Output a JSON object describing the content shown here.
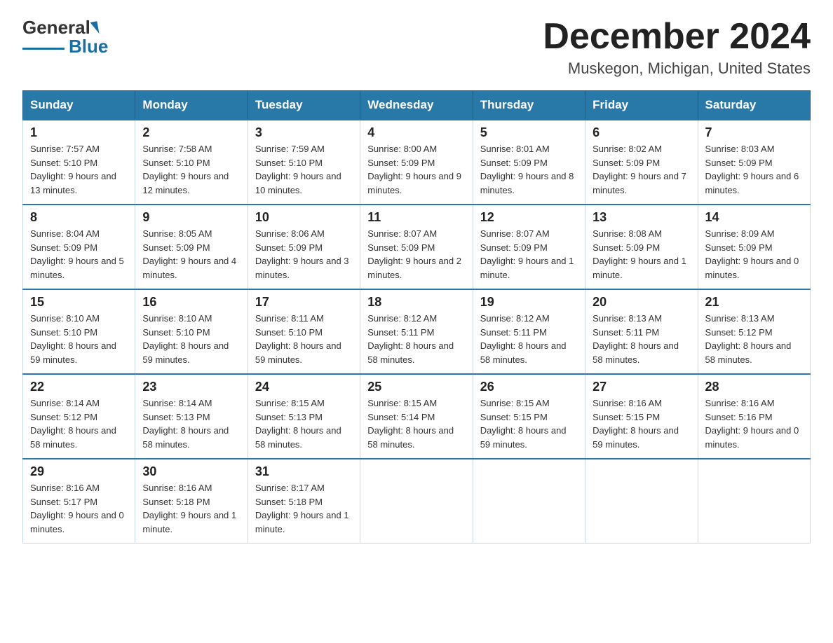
{
  "header": {
    "logo_general": "General",
    "logo_blue": "Blue",
    "title": "December 2024",
    "subtitle": "Muskegon, Michigan, United States"
  },
  "days_of_week": [
    "Sunday",
    "Monday",
    "Tuesday",
    "Wednesday",
    "Thursday",
    "Friday",
    "Saturday"
  ],
  "weeks": [
    [
      {
        "day": "1",
        "sunrise": "7:57 AM",
        "sunset": "5:10 PM",
        "daylight": "9 hours and 13 minutes."
      },
      {
        "day": "2",
        "sunrise": "7:58 AM",
        "sunset": "5:10 PM",
        "daylight": "9 hours and 12 minutes."
      },
      {
        "day": "3",
        "sunrise": "7:59 AM",
        "sunset": "5:10 PM",
        "daylight": "9 hours and 10 minutes."
      },
      {
        "day": "4",
        "sunrise": "8:00 AM",
        "sunset": "5:09 PM",
        "daylight": "9 hours and 9 minutes."
      },
      {
        "day": "5",
        "sunrise": "8:01 AM",
        "sunset": "5:09 PM",
        "daylight": "9 hours and 8 minutes."
      },
      {
        "day": "6",
        "sunrise": "8:02 AM",
        "sunset": "5:09 PM",
        "daylight": "9 hours and 7 minutes."
      },
      {
        "day": "7",
        "sunrise": "8:03 AM",
        "sunset": "5:09 PM",
        "daylight": "9 hours and 6 minutes."
      }
    ],
    [
      {
        "day": "8",
        "sunrise": "8:04 AM",
        "sunset": "5:09 PM",
        "daylight": "9 hours and 5 minutes."
      },
      {
        "day": "9",
        "sunrise": "8:05 AM",
        "sunset": "5:09 PM",
        "daylight": "9 hours and 4 minutes."
      },
      {
        "day": "10",
        "sunrise": "8:06 AM",
        "sunset": "5:09 PM",
        "daylight": "9 hours and 3 minutes."
      },
      {
        "day": "11",
        "sunrise": "8:07 AM",
        "sunset": "5:09 PM",
        "daylight": "9 hours and 2 minutes."
      },
      {
        "day": "12",
        "sunrise": "8:07 AM",
        "sunset": "5:09 PM",
        "daylight": "9 hours and 1 minute."
      },
      {
        "day": "13",
        "sunrise": "8:08 AM",
        "sunset": "5:09 PM",
        "daylight": "9 hours and 1 minute."
      },
      {
        "day": "14",
        "sunrise": "8:09 AM",
        "sunset": "5:09 PM",
        "daylight": "9 hours and 0 minutes."
      }
    ],
    [
      {
        "day": "15",
        "sunrise": "8:10 AM",
        "sunset": "5:10 PM",
        "daylight": "8 hours and 59 minutes."
      },
      {
        "day": "16",
        "sunrise": "8:10 AM",
        "sunset": "5:10 PM",
        "daylight": "8 hours and 59 minutes."
      },
      {
        "day": "17",
        "sunrise": "8:11 AM",
        "sunset": "5:10 PM",
        "daylight": "8 hours and 59 minutes."
      },
      {
        "day": "18",
        "sunrise": "8:12 AM",
        "sunset": "5:11 PM",
        "daylight": "8 hours and 58 minutes."
      },
      {
        "day": "19",
        "sunrise": "8:12 AM",
        "sunset": "5:11 PM",
        "daylight": "8 hours and 58 minutes."
      },
      {
        "day": "20",
        "sunrise": "8:13 AM",
        "sunset": "5:11 PM",
        "daylight": "8 hours and 58 minutes."
      },
      {
        "day": "21",
        "sunrise": "8:13 AM",
        "sunset": "5:12 PM",
        "daylight": "8 hours and 58 minutes."
      }
    ],
    [
      {
        "day": "22",
        "sunrise": "8:14 AM",
        "sunset": "5:12 PM",
        "daylight": "8 hours and 58 minutes."
      },
      {
        "day": "23",
        "sunrise": "8:14 AM",
        "sunset": "5:13 PM",
        "daylight": "8 hours and 58 minutes."
      },
      {
        "day": "24",
        "sunrise": "8:15 AM",
        "sunset": "5:13 PM",
        "daylight": "8 hours and 58 minutes."
      },
      {
        "day": "25",
        "sunrise": "8:15 AM",
        "sunset": "5:14 PM",
        "daylight": "8 hours and 58 minutes."
      },
      {
        "day": "26",
        "sunrise": "8:15 AM",
        "sunset": "5:15 PM",
        "daylight": "8 hours and 59 minutes."
      },
      {
        "day": "27",
        "sunrise": "8:16 AM",
        "sunset": "5:15 PM",
        "daylight": "8 hours and 59 minutes."
      },
      {
        "day": "28",
        "sunrise": "8:16 AM",
        "sunset": "5:16 PM",
        "daylight": "9 hours and 0 minutes."
      }
    ],
    [
      {
        "day": "29",
        "sunrise": "8:16 AM",
        "sunset": "5:17 PM",
        "daylight": "9 hours and 0 minutes."
      },
      {
        "day": "30",
        "sunrise": "8:16 AM",
        "sunset": "5:18 PM",
        "daylight": "9 hours and 1 minute."
      },
      {
        "day": "31",
        "sunrise": "8:17 AM",
        "sunset": "5:18 PM",
        "daylight": "9 hours and 1 minute."
      },
      null,
      null,
      null,
      null
    ]
  ],
  "labels": {
    "sunrise": "Sunrise:",
    "sunset": "Sunset:",
    "daylight": "Daylight:"
  }
}
